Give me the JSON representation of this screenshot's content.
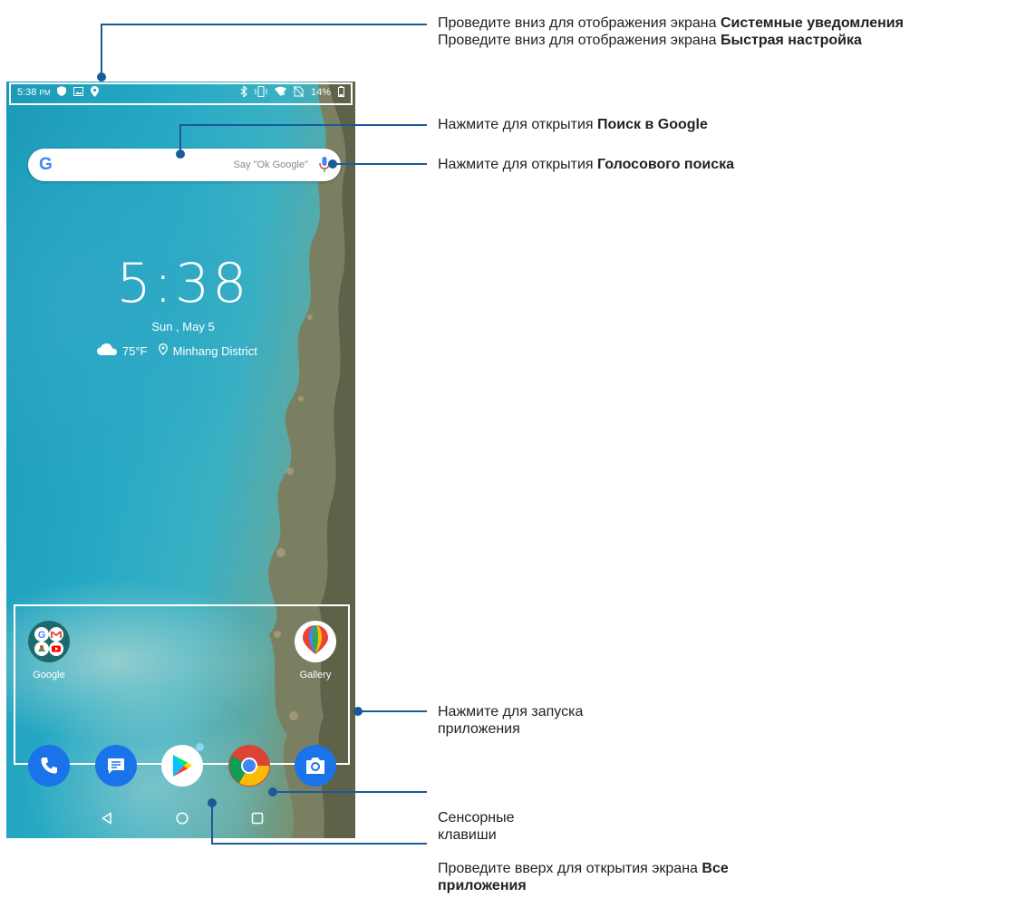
{
  "status_bar": {
    "time": "5:38",
    "time_suffix": "PM",
    "battery": "14%",
    "left_icons": [
      "shield-icon",
      "image-icon",
      "location-icon"
    ],
    "right_icons": [
      "bluetooth-icon",
      "vibrate-icon",
      "wifi-icon",
      "no-sim-icon",
      "battery-icon"
    ]
  },
  "search": {
    "hint": "Say \"Ok Google\"",
    "logo": "G"
  },
  "clock_widget": {
    "time": "5:38",
    "date": "Sun , May 5",
    "temperature": "75°F",
    "location": "Minhang District"
  },
  "apps": [
    {
      "label": "Google",
      "icon": "google-folder-icon"
    },
    {
      "label": "Gallery",
      "icon": "gallery-icon"
    }
  ],
  "dock": [
    "phone-icon",
    "messages-icon",
    "play-store-icon",
    "chrome-icon",
    "camera-icon"
  ],
  "navigation": [
    "back-icon",
    "home-icon",
    "recents-icon"
  ],
  "callouts": {
    "status": {
      "line1_text": "Проведите вниз для отображения экрана ",
      "line1_bold": "Системные уведомления",
      "line2_text": "Проведите вниз для отображения экрана ",
      "line2_bold": "Быстрая настройка"
    },
    "search": {
      "text": "Нажмите для открытия ",
      "bold": "Поиск в Google"
    },
    "voice": {
      "text": "Нажмите для открытия ",
      "bold": "Голосового поиска"
    },
    "apps": {
      "line1": "Нажмите для запуска",
      "line2": "приложения"
    },
    "keys": {
      "line1": "Сенсорные",
      "line2": "клавиши"
    },
    "all_apps": {
      "text": "Проведите вверх для открытия экрана ",
      "bold1": "Все",
      "bold2": "приложения"
    }
  },
  "colors": {
    "callout_line": "#1a5a99",
    "highlight": "#ffffff"
  }
}
